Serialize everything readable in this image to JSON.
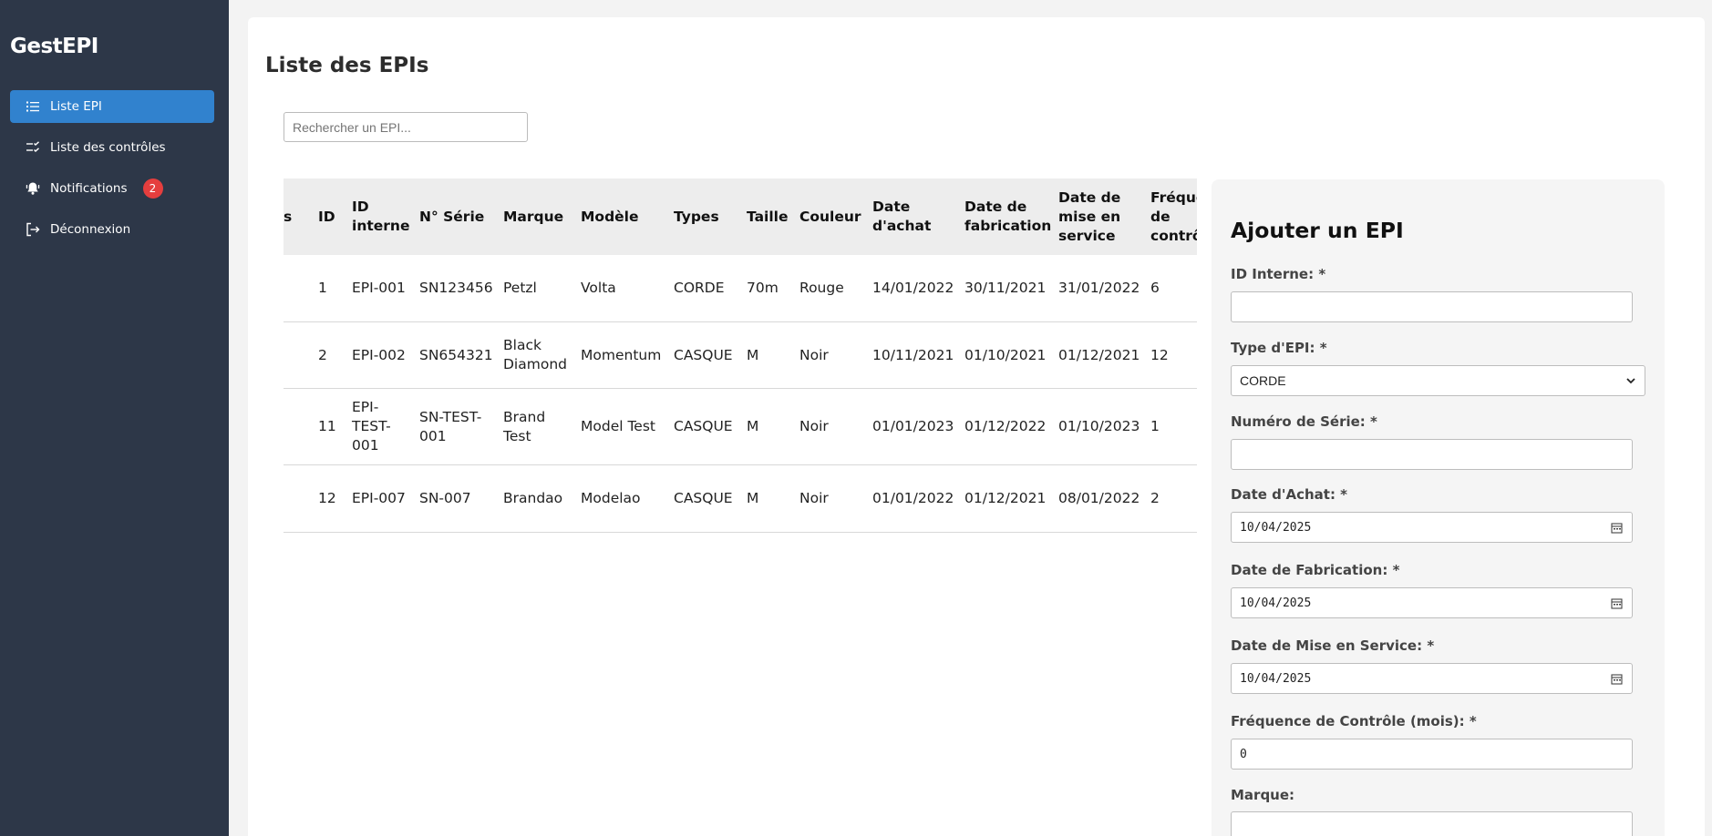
{
  "app": {
    "brand": "GestEPI"
  },
  "sidebar": {
    "items": [
      {
        "label": "Liste EPI",
        "icon": "list-icon"
      },
      {
        "label": "Liste des contrôles",
        "icon": "checklist-icon"
      },
      {
        "label": "Notifications",
        "icon": "bell-icon",
        "badge": "2"
      },
      {
        "label": "Déconnexion",
        "icon": "logout-icon"
      }
    ]
  },
  "main": {
    "title": "Liste des EPIs",
    "search": {
      "placeholder": "Rechercher un EPI...",
      "value": ""
    }
  },
  "table": {
    "headers": [
      "s",
      "ID",
      "ID interne",
      "N° Série",
      "Marque",
      "Modèle",
      "Types",
      "Taille",
      "Couleur",
      "Date d'achat",
      "Date de fabrication",
      "Date de mise en service",
      "Fréquence de contrôle"
    ],
    "rows": [
      [
        "",
        "1",
        "EPI-001",
        "SN123456",
        "Petzl",
        "Volta",
        "CORDE",
        "70m",
        "Rouge",
        "14/01/2022",
        "30/11/2021",
        "31/01/2022",
        "6"
      ],
      [
        "",
        "2",
        "EPI-002",
        "SN654321",
        "Black Diamond",
        "Momentum",
        "CASQUE",
        "M",
        "Noir",
        "10/11/2021",
        "01/10/2021",
        "01/12/2021",
        "12"
      ],
      [
        "",
        "11",
        "EPI-TEST-001",
        "SN-TEST-001",
        "Brand Test",
        "Model Test",
        "CASQUE",
        "M",
        "Noir",
        "01/01/2023",
        "01/12/2022",
        "01/10/2023",
        "1"
      ],
      [
        "",
        "12",
        "EPI-007",
        "SN-007",
        "Brandao",
        "Modelao",
        "CASQUE",
        "M",
        "Noir",
        "01/01/2022",
        "01/12/2021",
        "08/01/2022",
        "2"
      ]
    ]
  },
  "form": {
    "title": "Ajouter un EPI",
    "fields": [
      {
        "label": "ID Interne: *",
        "value": ""
      },
      {
        "label": "Type d'EPI: *",
        "value": "CORDE"
      },
      {
        "label": "Numéro de Série: *",
        "value": ""
      },
      {
        "label": "Date d'Achat: *",
        "value": "10/04/2025"
      },
      {
        "label": "Date de Fabrication: *",
        "value": "10/04/2025"
      },
      {
        "label": "Date de Mise en Service: *",
        "value": "10/04/2025"
      },
      {
        "label": "Fréquence de Contrôle (mois): *",
        "value": "0"
      },
      {
        "label": "Marque:",
        "value": ""
      }
    ]
  },
  "colors": {
    "sidebar_bg": "#2d3748",
    "accent": "#3182ce",
    "badge": "#e53e3e"
  }
}
